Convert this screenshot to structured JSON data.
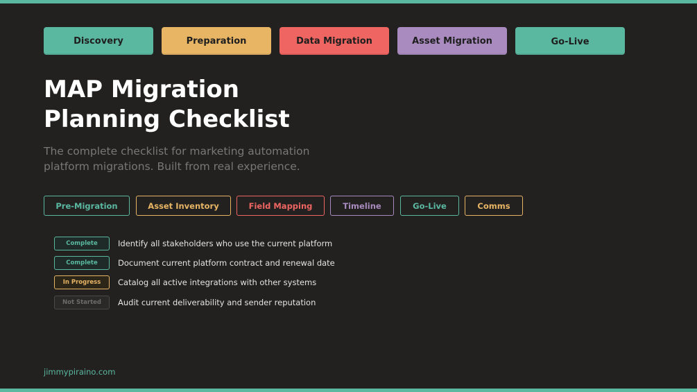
{
  "phases": [
    {
      "label": "Discovery"
    },
    {
      "label": "Preparation"
    },
    {
      "label": "Data Migration"
    },
    {
      "label": "Asset Migration"
    },
    {
      "label": "Go-Live"
    }
  ],
  "title": {
    "line1": "MAP Migration",
    "line2": "Planning Checklist"
  },
  "subtitle": {
    "line1": "The complete checklist for marketing automation",
    "line2": "platform migrations. Built from real experience."
  },
  "tabs": [
    {
      "label": "Pre-Migration"
    },
    {
      "label": "Asset Inventory"
    },
    {
      "label": "Field Mapping"
    },
    {
      "label": "Timeline"
    },
    {
      "label": "Go-Live"
    },
    {
      "label": "Comms"
    }
  ],
  "checklist": [
    {
      "status": "Complete",
      "text": "Identify all stakeholders who use the current platform"
    },
    {
      "status": "Complete",
      "text": "Document current platform contract and renewal date"
    },
    {
      "status": "In Progress",
      "text": "Catalog all active integrations with other systems"
    },
    {
      "status": "Not Started",
      "text": "Audit current deliverability and sender reputation"
    }
  ],
  "footer": {
    "link": "jimmypiraino.com"
  },
  "colors": {
    "background": "#222120",
    "teal": "#5bb8a0",
    "amber": "#e8b565",
    "red": "#ef6561",
    "purple": "#a98bbf"
  }
}
